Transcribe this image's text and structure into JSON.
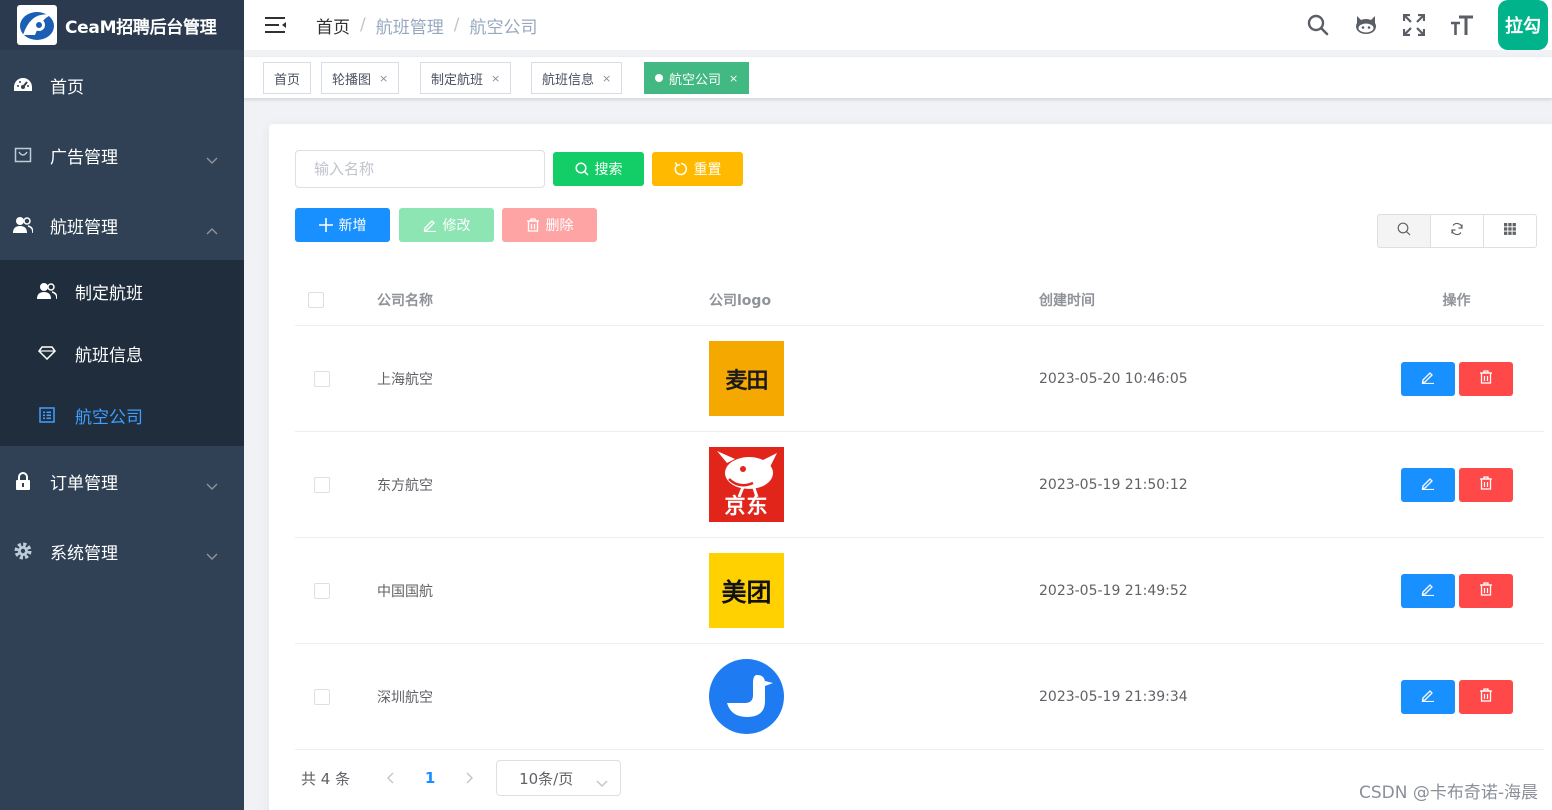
{
  "app": {
    "title": "CeaM招聘后台管理"
  },
  "sidebar": {
    "items": [
      {
        "label": "首页",
        "icon": "dashboard-icon"
      },
      {
        "label": "广告管理",
        "icon": "shopping-bag-icon"
      },
      {
        "label": "航班管理",
        "icon": "peoples-icon",
        "expanded": true,
        "children": [
          {
            "label": "制定航班",
            "icon": "peoples-icon"
          },
          {
            "label": "航班信息",
            "icon": "diamond-icon"
          },
          {
            "label": "航空公司",
            "icon": "list-icon",
            "active": true
          }
        ]
      },
      {
        "label": "订单管理",
        "icon": "lock-icon"
      },
      {
        "label": "系统管理",
        "icon": "gear-icon"
      }
    ]
  },
  "navbar": {
    "breadcrumb": [
      "首页",
      "航班管理",
      "航空公司"
    ],
    "separator": "/",
    "lagou_label": "拉勾"
  },
  "tags": [
    {
      "label": "首页",
      "closable": false
    },
    {
      "label": "轮播图",
      "closable": true
    },
    {
      "label": "制定航班",
      "closable": true
    },
    {
      "label": "航班信息",
      "closable": true
    },
    {
      "label": "航空公司",
      "closable": true,
      "active": true
    }
  ],
  "tag_close_glyph": "×",
  "search": {
    "placeholder": "输入名称",
    "search_label": "搜索",
    "reset_label": "重置"
  },
  "actions": {
    "add_label": "新增",
    "edit_label": "修改",
    "delete_label": "删除"
  },
  "table": {
    "columns": [
      "公司名称",
      "公司logo",
      "创建时间",
      "操作"
    ],
    "rows": [
      {
        "name": "上海航空",
        "logo": "maitian-logo",
        "logo_text": "麦田",
        "time": "2023-05-20 10:46:05"
      },
      {
        "name": "东方航空",
        "logo": "jd-logo",
        "logo_text": "京东",
        "time": "2023-05-19 21:50:12"
      },
      {
        "name": "中国国航",
        "logo": "meituan-logo",
        "logo_text": "美团",
        "time": "2023-05-19 21:49:52"
      },
      {
        "name": "深圳航空",
        "logo": "goose-logo",
        "time": "2023-05-19 21:39:34"
      }
    ]
  },
  "pagination": {
    "total_text": "共 4 条",
    "current_page": "1",
    "page_size": "10条/页"
  },
  "watermark": "CSDN @卡布奇诺-海晨",
  "colors": {
    "sidebar_bg": "#304156",
    "submenu_bg": "#1f2d3d",
    "active_menu": "#409eff",
    "success": "#13ce66",
    "warning": "#ffba00",
    "primary": "#1890ff",
    "danger": "#ff4949",
    "active_tag": "#42b983",
    "lagou": "#00b38a"
  }
}
